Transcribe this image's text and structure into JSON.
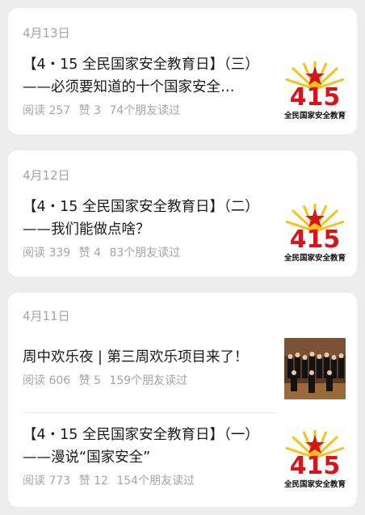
{
  "groups": [
    {
      "date": "4月13日",
      "articles": [
        {
          "title_line1": "【4・15 全民国家安全教育日】（三）",
          "title_line2": "——必须要知道的十个国家安全…",
          "reads": "阅读 257",
          "likes": "赞 3",
          "friends": "74个朋友读过",
          "thumb_text": "全民国家安全教育"
        }
      ]
    },
    {
      "date": "4月12日",
      "articles": [
        {
          "title_line1": "【4・15 全民国家安全教育日】（二）",
          "title_line2": "——我们能做点啥？",
          "reads": "阅读 339",
          "likes": "赞 4",
          "friends": "83个朋友读过",
          "thumb_text": "全民国家安全教育"
        }
      ]
    },
    {
      "date": "4月11日",
      "articles": [
        {
          "title_line1": "周中欢乐夜 | 第三周欢乐项目来了！",
          "reads": "阅读 606",
          "likes": "赞 5",
          "friends": "159个朋友读过"
        },
        {
          "title_line1": "【4・15 全民国家安全教育日】（一）",
          "title_line2": "——漫说“国家安全”",
          "reads": "阅读 773",
          "likes": "赞 12",
          "friends": "154个朋友读过",
          "thumb_text": "全民国家安全教育"
        }
      ]
    }
  ],
  "colors": {
    "background": "#ededed",
    "card": "#ffffff",
    "meta_text": "#a5a5a5",
    "title_text": "#1a1a1a",
    "poster_red": "#d7141a",
    "poster_yellow": "#f6c21a"
  }
}
